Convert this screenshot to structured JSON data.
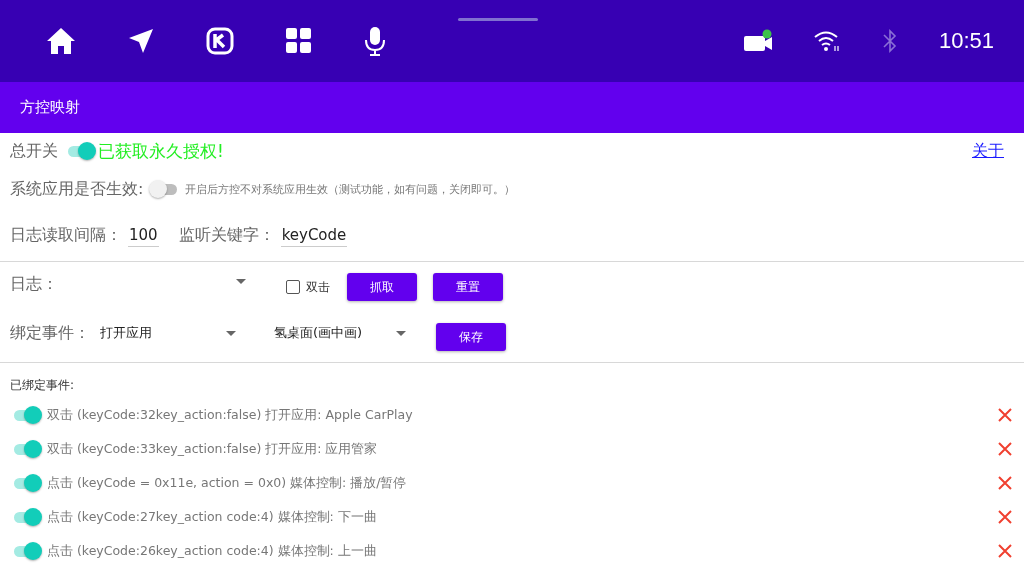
{
  "status_bar": {
    "time": "10:51",
    "bluetooth_on": false
  },
  "app_bar": {
    "title": "方控映射"
  },
  "master_switch": {
    "label": "总开关",
    "on": true,
    "status": "已获取永久授权!"
  },
  "about_link": "关于",
  "system_apps": {
    "label": "系统应用是否生效:",
    "on": false,
    "hint": "开启后方控不对系统应用生效（测试功能，如有问题，关闭即可。）"
  },
  "log_interval": {
    "label": "日志读取间隔：",
    "value": "100"
  },
  "keyword": {
    "label": "监听关键字：",
    "value": "keyCode"
  },
  "log": {
    "label": "日志："
  },
  "double_click": {
    "label": "双击",
    "checked": false
  },
  "log_buttons": [
    "抓取",
    "重置"
  ],
  "bind": {
    "label": "绑定事件：",
    "action": "打开应用",
    "app": "氢桌面(画中画)",
    "save": "保存"
  },
  "bound_events": {
    "title": "已绑定事件:",
    "items": [
      {
        "text": "双击 (keyCode:32key_action:false) 打开应用: Apple CarPlay",
        "on": true
      },
      {
        "text": "双击 (keyCode:33key_action:false) 打开应用: 应用管家",
        "on": true
      },
      {
        "text": "点击 (keyCode = 0x11e, action = 0x0) 媒体控制: 播放/暂停",
        "on": true
      },
      {
        "text": "点击 (keyCode:27key_action code:4) 媒体控制: 下一曲",
        "on": true
      },
      {
        "text": "点击 (keyCode:26key_action code:4) 媒体控制: 上一曲",
        "on": true
      }
    ]
  }
}
